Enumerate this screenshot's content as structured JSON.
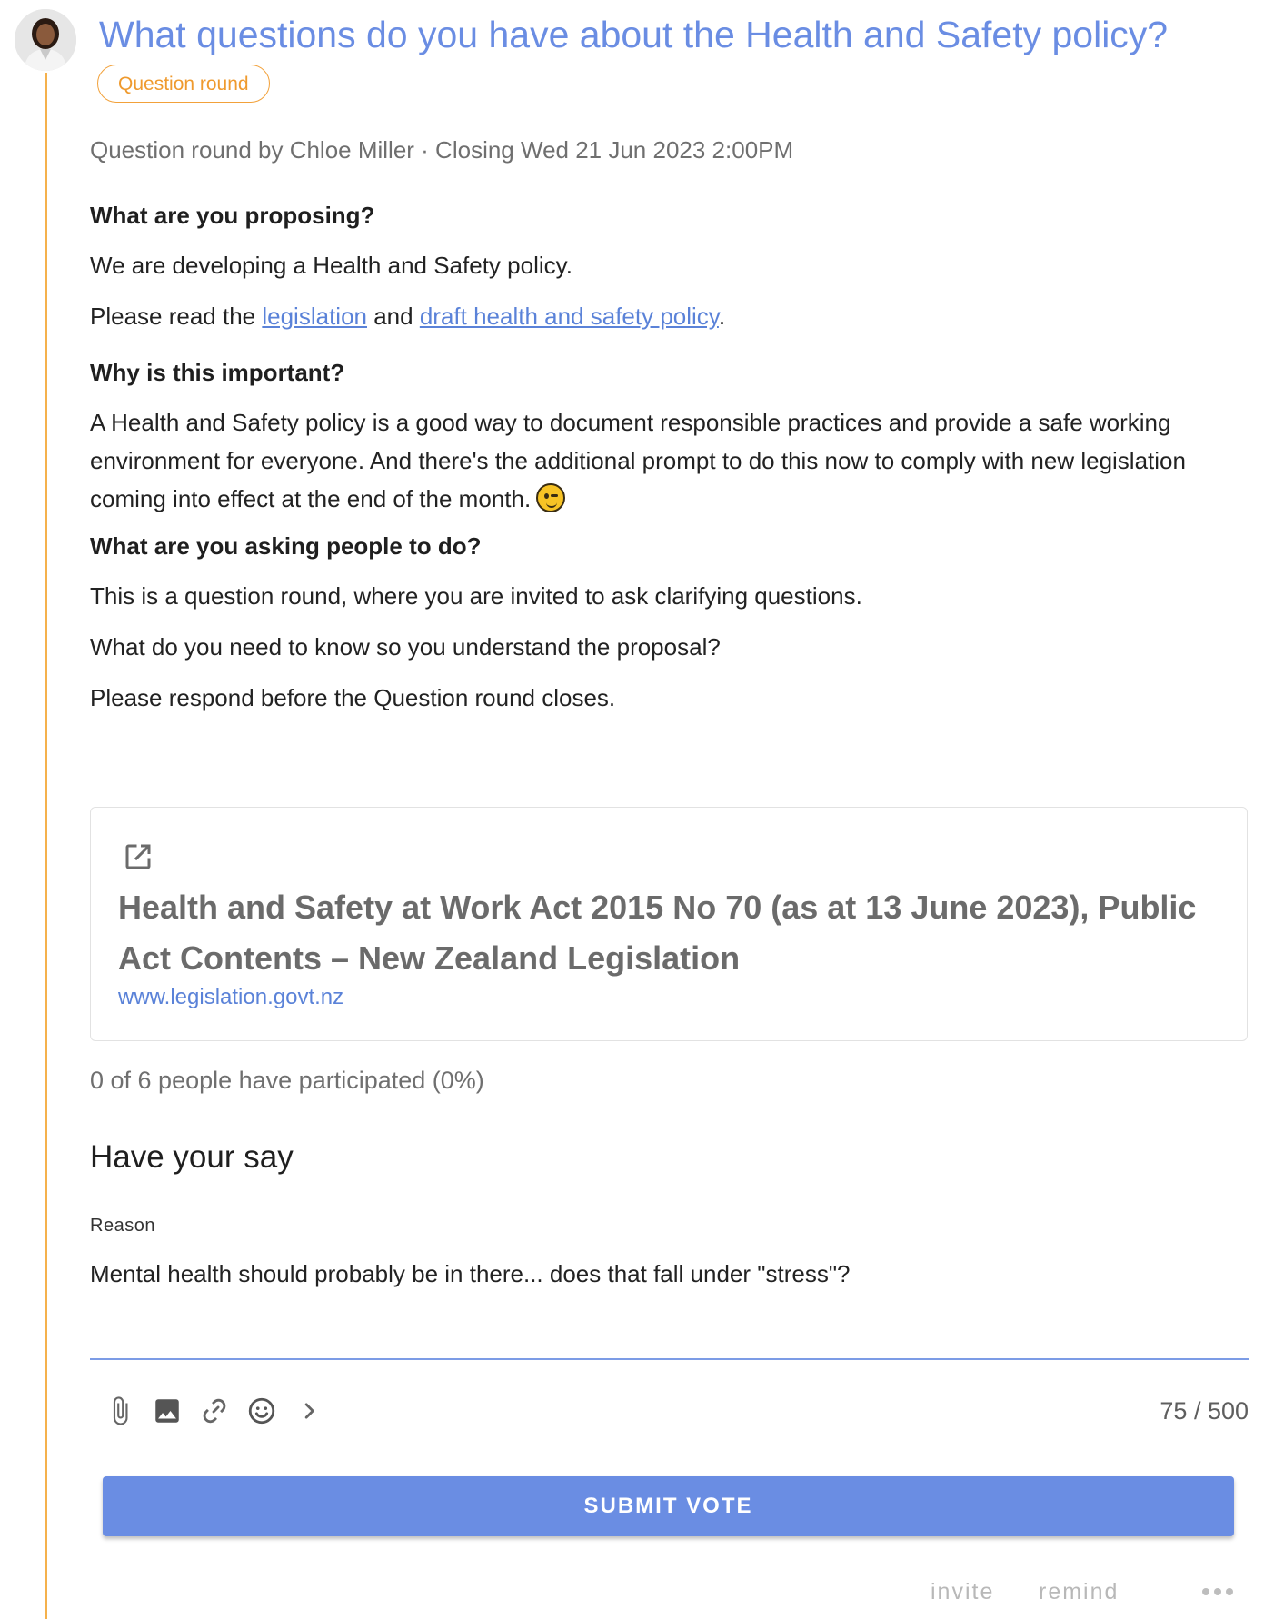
{
  "proposal": {
    "title": "What questions do you have about the Health and Safety policy?",
    "tag": "Question round",
    "meta": "Question round by Chloe Miller · Closing Wed 21 Jun 2023 2:00PM"
  },
  "details": {
    "h1": "What are you proposing?",
    "p1": "We are developing a Health and Safety policy.",
    "p2_prefix": "Please read the ",
    "p2_link1": "legislation",
    "p2_middle": " and ",
    "p2_link2": "draft health and safety policy",
    "p2_suffix": ".",
    "h2": "Why is this important?",
    "p3": "A Health and Safety policy is a good way to document responsible practices and provide a safe working environment for everyone. And there's the additional prompt to do this now to comply with new legislation coming into effect at the end of the month.",
    "h3": "What are you asking people to do?",
    "p4": "This is a question round, where you are invited to ask clarifying questions.",
    "p5": "What do you need to know so you understand the proposal?",
    "p6": "Please respond before the Question round closes."
  },
  "link_preview": {
    "icon": "open-in-new-icon",
    "title": "Health and Safety at Work Act 2015 No 70 (as at 13 June 2023), Public Act Contents – New Zealand Legislation",
    "url": "www.legislation.govt.nz"
  },
  "participation": "0 of 6 people have participated (0%)",
  "vote": {
    "heading": "Have your say",
    "reason_label": "Reason",
    "reason_text": "Mental health should probably be in there... does that fall under \"stress\"?",
    "counter": "75 / 500",
    "submit_label": "SUBMIT VOTE"
  },
  "toolbar_icons": [
    "paperclip-icon",
    "image-icon",
    "link-icon",
    "emoji-icon",
    "chevron-right-icon"
  ],
  "footer": {
    "invite": "invite",
    "remind": "remind"
  },
  "colors": {
    "accent": "#6a8de3",
    "tag": "#ef9a2e",
    "timeline": "#f5b14c",
    "link": "#5a82d8"
  }
}
